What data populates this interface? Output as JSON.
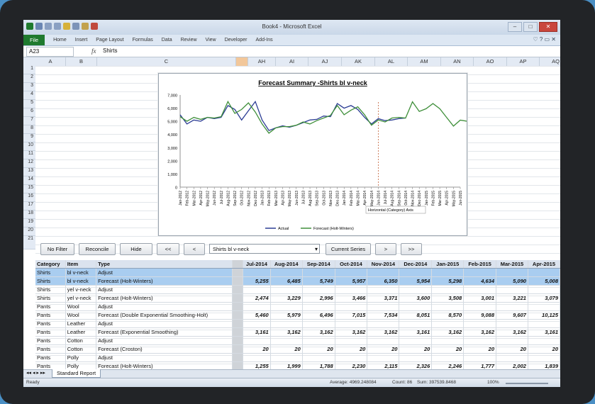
{
  "window": {
    "title": "Book4 - Microsoft Excel"
  },
  "ribbon": {
    "tabs": [
      "File",
      "Home",
      "Insert",
      "Page Layout",
      "Formulas",
      "Data",
      "Review",
      "View",
      "Developer",
      "Add-Ins"
    ]
  },
  "formula_bar": {
    "name_box": "A23",
    "fx": "fx",
    "value": "Shirts"
  },
  "columns": [
    {
      "label": "A",
      "w": 43
    },
    {
      "label": "B",
      "w": 44
    },
    {
      "label": "C",
      "w": 196
    },
    {
      "label": "",
      "w": 17
    },
    {
      "label": "AH",
      "w": 39
    },
    {
      "label": "AI",
      "w": 46
    },
    {
      "label": "AJ",
      "w": 47
    },
    {
      "label": "AK",
      "w": 47
    },
    {
      "label": "AL",
      "w": 46
    },
    {
      "label": "AM",
      "w": 47
    },
    {
      "label": "AN",
      "w": 46
    },
    {
      "label": "AO",
      "w": 47
    },
    {
      "label": "AP",
      "w": 46
    },
    {
      "label": "AQ",
      "w": 46
    }
  ],
  "row_numbers": [
    "1",
    "2",
    "3",
    "4",
    "5",
    "6",
    "7",
    "8",
    "9",
    "10",
    "11",
    "12",
    "13",
    "14",
    "15",
    "16",
    "17",
    "18",
    "19",
    "20",
    "21"
  ],
  "chart_data": {
    "type": "line",
    "title": "Forecast Summary -Shirts bl v-neck",
    "x_categories": [
      "Jan-2012",
      "Feb-2012",
      "Mar-2012",
      "Apr-2012",
      "May-2012",
      "Jun-2012",
      "Jul-2012",
      "Aug-2012",
      "Sep-2012",
      "Oct-2012",
      "Nov-2012",
      "Dec-2012",
      "Jan-2013",
      "Feb-2013",
      "Mar-2013",
      "Apr-2013",
      "May-2013",
      "Jun-2013",
      "Jul-2013",
      "Aug-2013",
      "Sep-2013",
      "Oct-2013",
      "Nov-2013",
      "Dec-2013",
      "Jan-2014",
      "Feb-2014",
      "Mar-2014",
      "Apr-2014",
      "May-2014",
      "Jun-2014",
      "Jul-2014",
      "Aug-2014",
      "Sep-2014",
      "Oct-2014",
      "Nov-2014",
      "Dec-2014",
      "Jan-2015",
      "Feb-2015",
      "Mar-2015",
      "Apr-2015",
      "May-2015",
      "Jun-2015"
    ],
    "ylim": [
      0,
      7000
    ],
    "yticks": [
      "0",
      "1,000",
      "2,000",
      "3,000",
      "4,000",
      "5,000",
      "6,000",
      "7,000"
    ],
    "legend_position": "bottom",
    "tooltip": "Horizontal (Category) Axis",
    "forecast_start_category": "Jun-2014",
    "series": [
      {
        "name": "Actual",
        "color": "#2c3d94",
        "values": [
          5500,
          4800,
          5100,
          5000,
          5300,
          5200,
          5300,
          6200,
          5900,
          5100,
          5800,
          6500,
          5100,
          4300,
          4500,
          4650,
          4550,
          4700,
          4900,
          5100,
          5150,
          5400,
          5350,
          6350,
          6000,
          6200,
          5900,
          5300,
          4800,
          5200,
          5050,
          5100,
          5200,
          5250,
          null,
          null,
          null,
          null,
          null,
          null,
          null,
          null
        ]
      },
      {
        "name": "Forecast (Holt-Winters)",
        "color": "#3f8f3a",
        "values": [
          5350,
          5000,
          5300,
          5150,
          5300,
          5250,
          5350,
          6500,
          5600,
          5900,
          6400,
          5700,
          4800,
          4100,
          4500,
          4600,
          4600,
          4700,
          4950,
          4800,
          5050,
          5250,
          5450,
          6200,
          5500,
          5850,
          6100,
          5500,
          4700,
          5100,
          4950,
          5250,
          5300,
          5250,
          6485,
          5749,
          5957,
          6350,
          5954,
          5298,
          4634,
          5090,
          5008
        ]
      }
    ]
  },
  "buttons": {
    "no_filter": "No Filter",
    "reconcile": "Reconcile",
    "hide": "Hide",
    "first": "<<",
    "prev": "<",
    "current_series": "Current Series",
    "next": ">",
    "last": ">>"
  },
  "series_combo": {
    "value": "Shirts bl v-neck"
  },
  "table": {
    "headers": [
      "Category",
      "Item",
      "Type",
      "Jul-2014",
      "Aug-2014",
      "Sep-2014",
      "Oct-2014",
      "Nov-2014",
      "Dec-2014",
      "Jan-2015",
      "Feb-2015",
      "Mar-2015",
      "Apr-2015"
    ],
    "rows": [
      {
        "n": "22",
        "hdr": true
      },
      {
        "n": "23",
        "sel": true,
        "c": [
          "Shirts",
          "bl v-neck",
          "Adjust",
          "",
          "",
          "",
          "",
          "",
          "",
          "",
          "",
          "",
          ""
        ]
      },
      {
        "n": "24",
        "sel": true,
        "c": [
          "Shirts",
          "bl v-neck",
          "Forecast (Holt-Winters)",
          "5,255",
          "6,485",
          "5,749",
          "5,957",
          "6,350",
          "5,954",
          "5,298",
          "4,634",
          "5,090",
          "5,008"
        ]
      },
      {
        "n": "25",
        "c": [
          "Shirts",
          "yel v-neck",
          "Adjust",
          "",
          "",
          "",
          "",
          "",
          "",
          "",
          "",
          "",
          ""
        ]
      },
      {
        "n": "26",
        "c": [
          "Shirts",
          "yel v-neck",
          "Forecast (Holt-Winters)",
          "2,474",
          "3,229",
          "2,996",
          "3,466",
          "3,371",
          "3,600",
          "3,508",
          "3,001",
          "3,221",
          "3,079"
        ]
      },
      {
        "n": "27",
        "c": [
          "Pants",
          "Wool",
          "Adjust",
          "",
          "",
          "",
          "",
          "",
          "",
          "",
          "",
          "",
          ""
        ]
      },
      {
        "n": "28",
        "c": [
          "Pants",
          "Wool",
          "Forecast (Double Exponential Smoothing-Holt)",
          "5,460",
          "5,979",
          "6,496",
          "7,015",
          "7,534",
          "8,051",
          "8,570",
          "9,088",
          "9,607",
          "10,125"
        ]
      },
      {
        "n": "29",
        "c": [
          "Pants",
          "Leather",
          "Adjust",
          "",
          "",
          "",
          "",
          "",
          "",
          "",
          "",
          "",
          ""
        ]
      },
      {
        "n": "30",
        "c": [
          "Pants",
          "Leather",
          "Forecast (Exponential Smoothing)",
          "3,161",
          "3,162",
          "3,162",
          "3,162",
          "3,162",
          "3,161",
          "3,162",
          "3,162",
          "3,162",
          "3,161"
        ]
      },
      {
        "n": "31",
        "c": [
          "Pants",
          "Cotton",
          "Adjust",
          "",
          "",
          "",
          "",
          "",
          "",
          "",
          "",
          "",
          ""
        ]
      },
      {
        "n": "32",
        "c": [
          "Pants",
          "Cotton",
          "Forecast (Croston)",
          "20",
          "20",
          "20",
          "20",
          "20",
          "20",
          "20",
          "20",
          "20",
          "20"
        ]
      },
      {
        "n": "33",
        "c": [
          "Pants",
          "Polly",
          "Adjust",
          "",
          "",
          "",
          "",
          "",
          "",
          "",
          "",
          "",
          ""
        ]
      },
      {
        "n": "34",
        "c": [
          "Pants",
          "Polly",
          "Forecast (Holt-Winters)",
          "1,255",
          "1,999",
          "1,788",
          "2,230",
          "2,115",
          "2,326",
          "2,246",
          "1,777",
          "2,002",
          "1,839"
        ]
      }
    ]
  },
  "sheet_tab": "Standard Report",
  "status": {
    "ready": "Ready",
    "average": "Average: 4969.248084",
    "count": "Count: 86",
    "sum": "Sum: 397539.8468",
    "zoom": "100%"
  }
}
